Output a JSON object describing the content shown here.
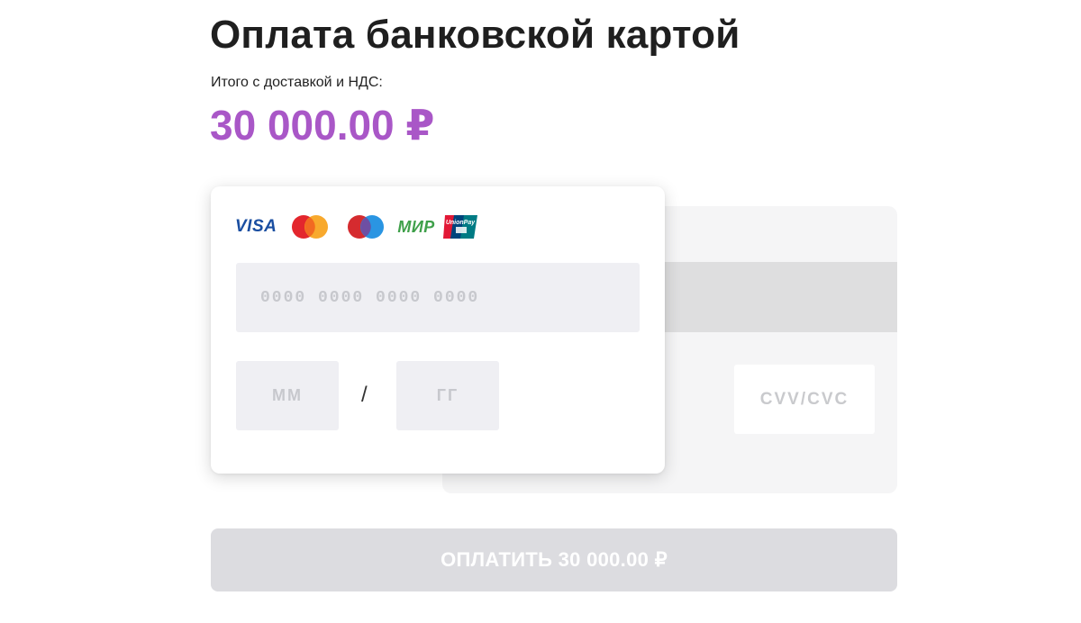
{
  "page": {
    "title": "Оплата банковской картой",
    "total_label": "Итого с доставкой и НДС:",
    "amount": "30 000.00 ₽"
  },
  "card_form": {
    "logos": [
      {
        "name": "visa-logo",
        "text": "VISA"
      },
      {
        "name": "mastercard-logo",
        "text": ""
      },
      {
        "name": "maestro-logo",
        "text": ""
      },
      {
        "name": "mir-logo",
        "text": "МИР"
      },
      {
        "name": "unionpay-logo",
        "text": "UnionPay"
      }
    ],
    "card_number": {
      "value": "",
      "placeholder": "0000 0000 0000 0000"
    },
    "expiry_month": {
      "value": "",
      "placeholder": "ММ"
    },
    "expiry_separator": "/",
    "expiry_year": {
      "value": "",
      "placeholder": "ГГ"
    },
    "cvv": {
      "value": "",
      "placeholder": "CVV/CVC"
    }
  },
  "pay_button": {
    "label": "ОПЛАТИТЬ 30 000.00 ₽"
  },
  "colors": {
    "accent": "#a957c7",
    "input_bg": "#efeff3",
    "button_disabled": "#dcdce0",
    "visa": "#1a4ea1",
    "mir": "#3fa04a"
  }
}
